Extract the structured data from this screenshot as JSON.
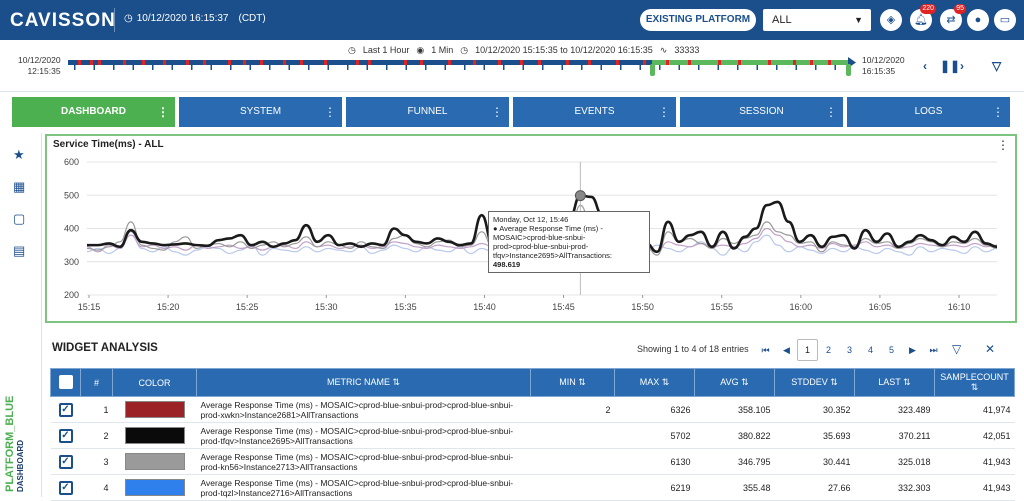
{
  "header": {
    "brand": "CAVISSON",
    "datetime": "10/12/2020 16:15:37",
    "timezone": "(CDT)",
    "platform_button": "EXISTING PLATFORM",
    "selector_value": "ALL",
    "notif_count_1": "220",
    "notif_count_2": "95"
  },
  "timeline": {
    "duration": "Last 1 Hour",
    "interval": "1 Min",
    "range": "10/12/2020 15:15:35 to 10/12/2020 16:15:35",
    "count": "33333",
    "start_date": "10/12/2020",
    "start_time": "12:15:35",
    "end_date": "10/12/2020",
    "end_time": "16:15:35"
  },
  "tabs": [
    {
      "label": "DASHBOARD"
    },
    {
      "label": "SYSTEM"
    },
    {
      "label": "FUNNEL"
    },
    {
      "label": "EVENTS"
    },
    {
      "label": "SESSION"
    },
    {
      "label": "LOGS"
    }
  ],
  "sidebar": {
    "vertical_label": "PLATFORM_BLUE",
    "vertical_sublabel": "DASHBOARD"
  },
  "chart": {
    "title": "Service Time(ms) - ALL",
    "tooltip": {
      "line1": "Monday, Oct 12, 15:46",
      "line2": "● Average Response Time (ms) -",
      "line3": "MOSAIC>cprod-blue-snbui-",
      "line4": "prod>cprod-blue-snbui-prod-",
      "line5": "tfqv>Instance2695>AllTransactions:",
      "value": "498.619"
    }
  },
  "chart_data": {
    "type": "line",
    "title": "Service Time(ms) - ALL",
    "ylim": [
      200,
      600
    ],
    "yticks": [
      "600",
      "500",
      "400",
      "300",
      "200"
    ],
    "xticks": [
      "15:15",
      "15:20",
      "15:25",
      "15:30",
      "15:35",
      "15:40",
      "15:45",
      "15:50",
      "15:55",
      "16:00",
      "16:05",
      "16:10"
    ],
    "series": [
      {
        "color": "#1a1a1a",
        "values": [
          350,
          350,
          355,
          345,
          395,
          360,
          355,
          350,
          352,
          355,
          350,
          348,
          365,
          370,
          380,
          350,
          360,
          345,
          355,
          365,
          410,
          360,
          380,
          350,
          355,
          345,
          355,
          350,
          400,
          380,
          360,
          355,
          370,
          360,
          350,
          355,
          440,
          355,
          350,
          360,
          355,
          395,
          360,
          365,
          430,
          499,
          495,
          440,
          360,
          350,
          410,
          355,
          330,
          420,
          360,
          380,
          390,
          345,
          390,
          340,
          375,
          400,
          470,
          480,
          420,
          360,
          380,
          345,
          375,
          380,
          340,
          395,
          360,
          385,
          345,
          360,
          380,
          365,
          350,
          375,
          360,
          390,
          355,
          345
        ]
      },
      {
        "color": "#999999",
        "values": [
          340,
          335,
          345,
          360,
          420,
          350,
          340,
          335,
          360,
          375,
          340,
          350,
          355,
          345,
          360,
          340,
          350,
          360,
          345,
          355,
          375,
          345,
          360,
          350,
          340,
          360,
          345,
          340,
          370,
          380,
          355,
          345,
          360,
          365,
          345,
          350,
          390,
          345,
          355,
          350,
          340,
          360,
          350,
          355,
          380,
          470,
          410,
          380,
          420,
          340,
          355,
          345,
          320,
          390,
          360,
          370,
          355,
          340,
          370,
          355,
          370,
          380,
          420,
          390,
          380,
          355,
          360,
          330,
          360,
          350,
          345,
          370,
          355,
          360,
          340,
          355,
          370,
          360,
          345,
          360,
          355,
          370,
          350,
          340
        ]
      },
      {
        "color": "#b9c8ea",
        "values": [
          330,
          340,
          325,
          340,
          390,
          340,
          330,
          345,
          330,
          320,
          335,
          345,
          340,
          325,
          335,
          350,
          320,
          340,
          335,
          330,
          345,
          330,
          340,
          335,
          330,
          345,
          325,
          335,
          350,
          340,
          330,
          345,
          335,
          330,
          345,
          325,
          340,
          330,
          345,
          325,
          340,
          330,
          335,
          330,
          350,
          380,
          370,
          360,
          350,
          320,
          300,
          330,
          350,
          340,
          330,
          345,
          360,
          340,
          320,
          345,
          330,
          360,
          380,
          350,
          330,
          345,
          335,
          325,
          340,
          330,
          345,
          335,
          325,
          340,
          330,
          320,
          345,
          330,
          340,
          335,
          325,
          345,
          330,
          340
        ]
      },
      {
        "color": "#c2a0c8",
        "values": [
          345,
          330,
          350,
          340,
          380,
          345,
          350,
          340,
          345,
          335,
          350,
          340,
          345,
          350,
          340,
          345,
          335,
          345,
          350,
          340,
          360,
          345,
          350,
          340,
          345,
          350,
          340,
          345,
          360,
          355,
          345,
          340,
          350,
          345,
          340,
          345,
          355,
          345,
          350,
          345,
          340,
          350,
          345,
          350,
          360,
          420,
          380,
          360,
          340,
          345,
          350,
          340,
          330,
          360,
          350,
          345,
          355,
          345,
          350,
          345,
          355,
          370,
          400,
          380,
          360,
          345,
          350,
          340,
          355,
          345,
          350,
          360,
          345,
          350,
          340,
          345,
          355,
          350,
          345,
          350,
          345,
          355,
          345,
          350
        ]
      }
    ]
  },
  "widget_analysis": {
    "title": "WIDGET ANALYSIS",
    "showing": "Showing 1 to 4 of 18 entries",
    "pages": [
      "1",
      "2",
      "3",
      "4",
      "5"
    ],
    "columns": [
      "#",
      "COLOR",
      "METRIC NAME ⇅",
      "MIN ⇅",
      "MAX ⇅",
      "AVG ⇅",
      "STDDEV ⇅",
      "LAST ⇅",
      "SAMPLECOUNT ⇅"
    ],
    "rows": [
      {
        "n": "1",
        "color": "#9b2226",
        "metric": "Average Response Time (ms) - MOSAIC>cprod-blue-snbui-prod>cprod-blue-snbui-prod-xwkn>Instance2681>AllTransactions",
        "min": "2",
        "max": "6326",
        "avg": "358.105",
        "stddev": "30.352",
        "last": "323.489",
        "count": "41,974"
      },
      {
        "n": "2",
        "color": "#0a0a0a",
        "metric": "Average Response Time (ms) - MOSAIC>cprod-blue-snbui-prod>cprod-blue-snbui-prod-tfqv>Instance2695>AllTransactions",
        "min": "",
        "max": "5702",
        "avg": "380.822",
        "stddev": "35.693",
        "last": "370.211",
        "count": "42,051"
      },
      {
        "n": "3",
        "color": "#9a9a9a",
        "metric": "Average Response Time (ms) - MOSAIC>cprod-blue-snbui-prod>cprod-blue-snbui-prod-kn56>Instance2713>AllTransactions",
        "min": "",
        "max": "6130",
        "avg": "346.795",
        "stddev": "30.441",
        "last": "325.018",
        "count": "41,943"
      },
      {
        "n": "4",
        "color": "#2f80ed",
        "metric": "Average Response Time (ms) - MOSAIC>cprod-blue-snbui-prod>cprod-blue-snbui-prod-tqzl>Instance2716>AllTransactions",
        "min": "",
        "max": "6219",
        "avg": "355.48",
        "stddev": "27.66",
        "last": "332.303",
        "count": "41,943"
      }
    ]
  }
}
